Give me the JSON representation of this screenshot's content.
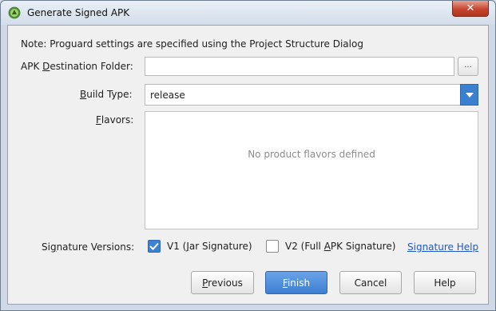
{
  "window": {
    "title": "Generate Signed APK",
    "close_glyph": "✕"
  },
  "note": "Note: Proguard settings are specified using the Project Structure Dialog",
  "destination": {
    "label_pre": "APK ",
    "label_mnemonic": "D",
    "label_post": "estination Folder:",
    "value": "",
    "browse_label": "..."
  },
  "build_type": {
    "label_mnemonic": "B",
    "label_post": "uild Type:",
    "selected": "release"
  },
  "flavors": {
    "label_mnemonic": "F",
    "label_post": "lavors:",
    "empty_text": "No product flavors defined"
  },
  "signature": {
    "label_pre": "Si",
    "label_mnemonic": "g",
    "label_post": "nature Versions:",
    "v1": {
      "label_pre": "V1 (",
      "label_mnemonic": "J",
      "label_post": "ar Signature)",
      "checked": true
    },
    "v2": {
      "label_pre": "V2 (Full ",
      "label_mnemonic": "A",
      "label_post": "PK Signature)",
      "checked": false
    },
    "help_link": "Signature Help"
  },
  "buttons": {
    "previous": {
      "mnemonic": "P",
      "rest": "revious"
    },
    "finish": {
      "mnemonic": "F",
      "rest": "inish"
    },
    "cancel": "Cancel",
    "help": "Help"
  },
  "colors": {
    "accent": "#3b7fd1",
    "link": "#2258c4",
    "close": "#c6452e"
  }
}
